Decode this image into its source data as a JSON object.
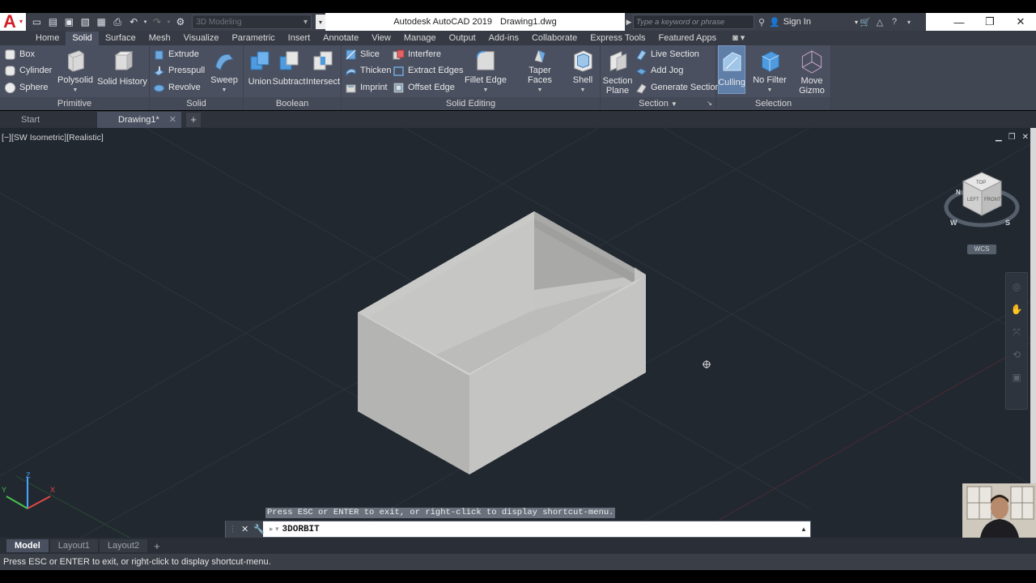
{
  "window": {
    "title_app": "Autodesk AutoCAD 2019",
    "title_file": "Drawing1.dwg"
  },
  "qat": {
    "workspace": "3D Modeling"
  },
  "search": {
    "placeholder": "Type a keyword or phrase",
    "signin": "Sign In"
  },
  "ribbon_tabs": [
    "Home",
    "Solid",
    "Surface",
    "Mesh",
    "Visualize",
    "Parametric",
    "Insert",
    "Annotate",
    "View",
    "Manage",
    "Output",
    "Add-ins",
    "Collaborate",
    "Express Tools",
    "Featured Apps"
  ],
  "ribbon": {
    "primitive": {
      "title": "Primitive",
      "box": "Box",
      "cylinder": "Cylinder",
      "sphere": "Sphere",
      "polysolid": "Polysolid",
      "solid_history": "Solid History"
    },
    "solid": {
      "title": "Solid",
      "extrude": "Extrude",
      "presspull": "Presspull",
      "revolve": "Revolve",
      "sweep": "Sweep"
    },
    "boolean": {
      "title": "Boolean",
      "union": "Union",
      "subtract": "Subtract",
      "intersect": "Intersect"
    },
    "solid_editing": {
      "title": "Solid Editing",
      "slice": "Slice",
      "thicken": "Thicken",
      "imprint": "Imprint",
      "interfere": "Interfere",
      "extract_edges": "Extract Edges",
      "offset_edge": "Offset Edge",
      "fillet_edge": "Fillet Edge",
      "taper_faces": "Taper Faces",
      "shell": "Shell"
    },
    "section": {
      "title": "Section",
      "section_plane_1": "Section",
      "section_plane_2": "Plane",
      "live_section": "Live Section",
      "add_jog": "Add Jog",
      "generate_section": "Generate Section"
    },
    "selection": {
      "title": "Selection",
      "culling": "Culling",
      "no_filter": "No Filter",
      "move_gizmo_1": "Move",
      "move_gizmo_2": "Gizmo"
    }
  },
  "file_tabs": {
    "start": "Start",
    "drawing": "Drawing1*"
  },
  "viewport": {
    "label": "[−][SW Isometric][Realistic]",
    "wcs": "WCS",
    "viewcube": {
      "top": "TOP",
      "left": "LEFT",
      "front": "FRONT",
      "n": "N",
      "w": "W",
      "s": "S"
    },
    "ucs": {
      "x": "X",
      "y": "Y",
      "z": "Z"
    }
  },
  "command": {
    "hint": "Press ESC or ENTER to exit, or right-click to display shortcut-menu.",
    "current": "3DORBIT"
  },
  "layout_tabs": [
    "Model",
    "Layout1",
    "Layout2"
  ],
  "status": {
    "text": "Press ESC or ENTER to exit, or right-click to display shortcut-menu."
  },
  "colors": {
    "accent_logo": "#d41f26",
    "ribbon_bg": "#4a5060",
    "viewport_bg": "#212830",
    "highlight": "#5f7ea8"
  }
}
